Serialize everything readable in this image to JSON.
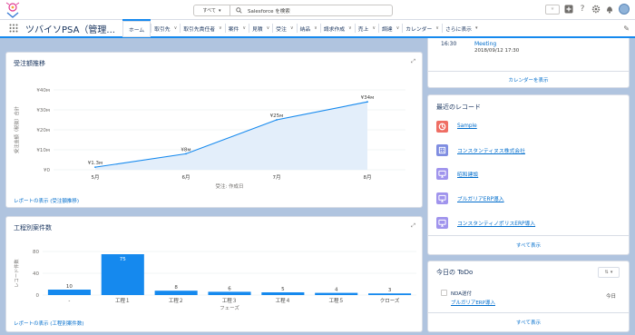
{
  "header": {
    "search_scope": "すべて",
    "search_placeholder": "Salesforce を検索"
  },
  "nav": {
    "app_name": "ツバイソPSA（管理...",
    "tabs": [
      {
        "label": "ホーム",
        "active": true
      },
      {
        "label": "取引先"
      },
      {
        "label": "取引先責任者"
      },
      {
        "label": "案件"
      },
      {
        "label": "見積"
      },
      {
        "label": "受注"
      },
      {
        "label": "納品"
      },
      {
        "label": "請求作成"
      },
      {
        "label": "売上"
      },
      {
        "label": "調達"
      },
      {
        "label": "カレンダー"
      },
      {
        "label": "さらに表示"
      }
    ]
  },
  "order_chart": {
    "title": "受注額推移",
    "footer_link": "レポートの表示 (受注額推移)",
    "chart_data": {
      "type": "area",
      "categories": [
        "5月",
        "6月",
        "7月",
        "8月"
      ],
      "values": [
        1.3,
        8,
        25,
        34
      ],
      "data_labels": [
        "¥1.3м",
        "¥8м",
        "¥25м",
        "¥34м"
      ],
      "yticks": [
        "¥40м",
        "¥30м",
        "¥20м",
        "¥10м",
        "¥0"
      ],
      "ylim": [
        0,
        40
      ],
      "xlabel": "受注: 作成日",
      "ylabel": "受注金額（税抜）合計",
      "grid": true,
      "color": "#1589ee"
    }
  },
  "phase_chart": {
    "title": "工程別案件数",
    "footer_link": "レポートの表示 (工程別案件数)",
    "chart_data": {
      "type": "bar",
      "categories": [
        "-",
        "工程１",
        "工程２",
        "工程３",
        "工程４",
        "工程５",
        "クローズ"
      ],
      "values": [
        10,
        75,
        8,
        6,
        5,
        4,
        3
      ],
      "yticks": [
        "80",
        "40",
        "0"
      ],
      "ylim": [
        0,
        80
      ],
      "xlabel": "フェーズ",
      "ylabel": "レコード件数",
      "grid": true,
      "color": "#1589ee"
    }
  },
  "calendar": {
    "event_time": "16:30",
    "event_title": "Meeting",
    "event_sub": "2018/09/12 17:30",
    "link": "カレンダーを表示"
  },
  "recent": {
    "title": "最近のレコード",
    "items": [
      {
        "label": "Sample",
        "icon": "opportunity-icon",
        "color": "#ef6e64"
      },
      {
        "label": "コンスタンティヌス株式会社",
        "icon": "account-icon",
        "color": "#7f8de1"
      },
      {
        "label": "昭和建設",
        "icon": "monitor-icon",
        "color": "#a094ed"
      },
      {
        "label": "ブルガリアERP導入",
        "icon": "monitor-icon",
        "color": "#a094ed"
      },
      {
        "label": "コンスタンティノポリスERP導入",
        "icon": "monitor-icon",
        "color": "#a094ed"
      }
    ],
    "link": "すべて表示"
  },
  "todo": {
    "title": "今日の ToDo",
    "task_title": "NDA送付",
    "task_related": "ブルガリアERP導入",
    "task_date": "今日",
    "link": "すべて表示"
  }
}
